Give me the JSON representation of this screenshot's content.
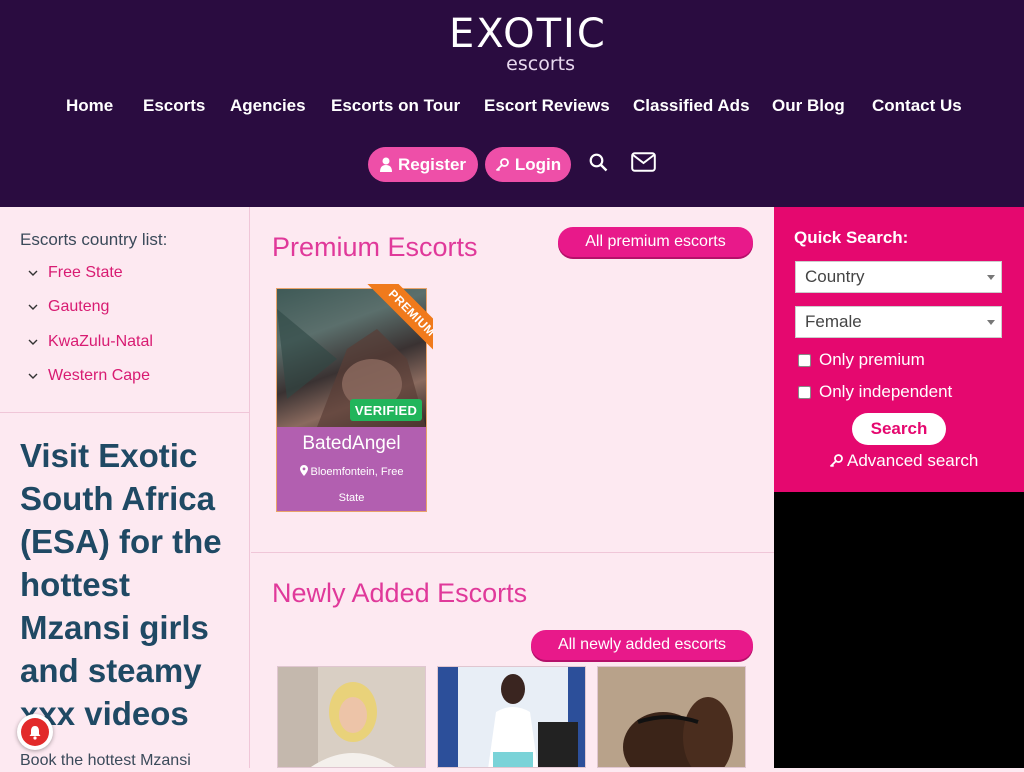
{
  "header": {
    "logo_main": "EXOTIC",
    "logo_sub": "escorts",
    "nav": [
      "Home",
      "Escorts",
      "Agencies",
      "Escorts on Tour",
      "Escort Reviews",
      "Classified Ads",
      "Our Blog",
      "Contact Us"
    ],
    "register_label": "Register",
    "login_label": "Login"
  },
  "sidebar": {
    "country_heading": "Escorts country list:",
    "countries": [
      "Free State",
      "Gauteng",
      "KwaZulu-Natal",
      "Western Cape"
    ],
    "promo_heading": "Visit Exotic South Africa (ESA) for the hottest Mzansi girls and steamy xxx videos",
    "promo_text": "Book the hottest Mzansi"
  },
  "premium": {
    "title": "Premium Escorts",
    "all_button": "All premium escorts",
    "card": {
      "ribbon": "PREMIUM",
      "badge": "VERIFIED",
      "name": "BatedAngel",
      "location": "Bloemfontein, Free State"
    }
  },
  "newly_added": {
    "title": "Newly Added Escorts",
    "all_button": "All newly added escorts"
  },
  "quick_search": {
    "title": "Quick Search:",
    "country_select": "Country",
    "gender_select": "Female",
    "only_premium": "Only premium",
    "only_independent": "Only independent",
    "search_button": "Search",
    "advanced": "Advanced search"
  },
  "colors": {
    "header_bg": "#2a0c40",
    "accent_pink": "#e5086f",
    "button_pink": "#ee4fa8",
    "title_pink": "#e0399a",
    "promo_blue": "#1f4964",
    "verified_green": "#21b55b",
    "ribbon_orange": "#f07a1c",
    "card_info": "#b25fb0"
  },
  "icons": [
    "user-icon",
    "key-icon",
    "search-icon",
    "envelope-icon",
    "chevron-down-icon",
    "map-pin-icon",
    "bell-icon"
  ]
}
